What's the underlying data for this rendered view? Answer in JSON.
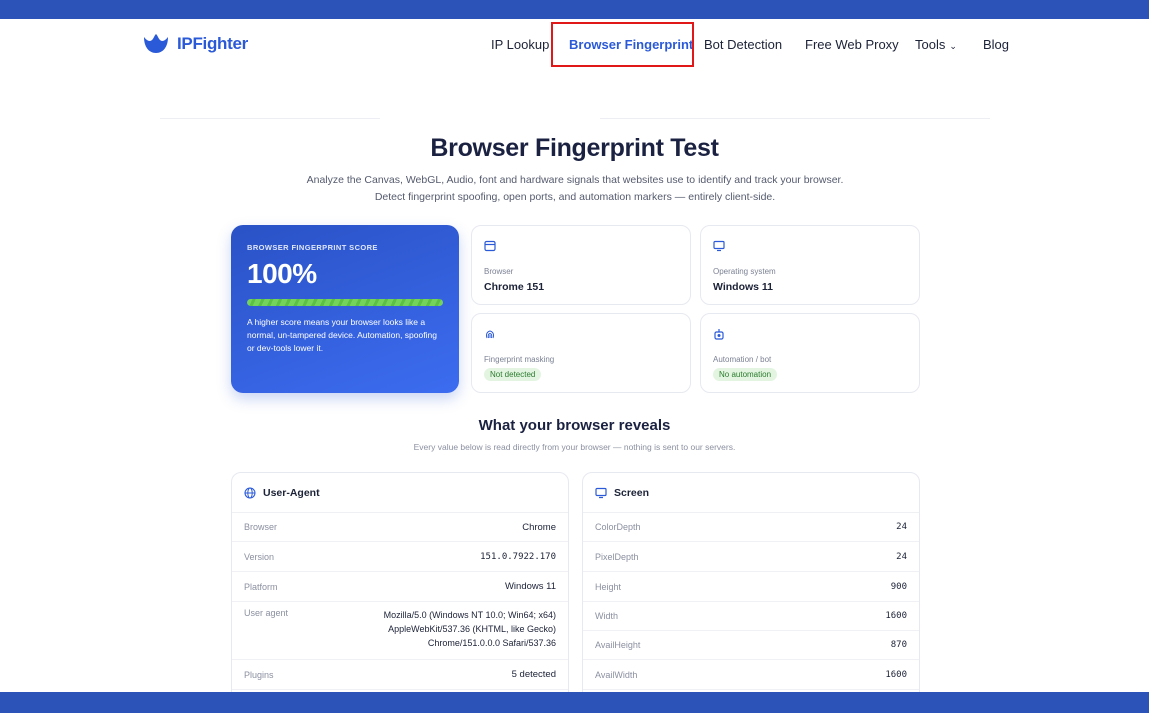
{
  "header": {
    "logo_text": "IPFighter",
    "nav": [
      {
        "label": "IP Lookup"
      },
      {
        "label": "Browser Fingerprint"
      },
      {
        "label": "Bot Detection"
      },
      {
        "label": "Free Web Proxy"
      },
      {
        "label": "Tools"
      },
      {
        "label": "Blog"
      }
    ]
  },
  "hero": {
    "title": "Browser Fingerprint Test",
    "subtitle": "Analyze the Canvas, WebGL, Audio, font and hardware signals that websites use to identify and track your browser. Detect fingerprint spoofing, open ports, and automation markers — entirely client-side."
  },
  "score": {
    "label": "BROWSER FINGERPRINT SCORE",
    "value": "100%",
    "percent": 100,
    "description": "A higher score means your browser looks like a normal, un-tampered device. Automation, spoofing or dev-tools lower it."
  },
  "cards": {
    "browser": {
      "label": "Browser",
      "value": "Chrome 151"
    },
    "os": {
      "label": "Operating system",
      "value": "Windows 11"
    },
    "masking": {
      "label": "Fingerprint masking",
      "badge": "Not detected"
    },
    "automation": {
      "label": "Automation / bot",
      "badge": "No automation"
    }
  },
  "reveals": {
    "title": "What your browser reveals",
    "subtitle": "Every value below is read directly from your browser — nothing is sent to our servers."
  },
  "user_agent_panel": {
    "title": "User-Agent",
    "rows": [
      {
        "label": "Browser",
        "value": "Chrome"
      },
      {
        "label": "Version",
        "value": "151.0.7922.170"
      },
      {
        "label": "Platform",
        "value": "Windows 11"
      },
      {
        "label": "User agent",
        "value": "Mozilla/5.0 (Windows NT 10.0; Win64; x64) AppleWebKit/537.36 (KHTML, like Gecko) Chrome/151.0.0.0 Safari/537.36"
      },
      {
        "label": "Plugins",
        "value": "5 detected"
      }
    ]
  },
  "screen_panel": {
    "title": "Screen",
    "rows": [
      {
        "label": "ColorDepth",
        "value": "24"
      },
      {
        "label": "PixelDepth",
        "value": "24"
      },
      {
        "label": "Height",
        "value": "900"
      },
      {
        "label": "Width",
        "value": "1600"
      },
      {
        "label": "AvailHeight",
        "value": "870"
      },
      {
        "label": "AvailWidth",
        "value": "1600"
      }
    ]
  },
  "colors": {
    "brand": "#2b5ad8",
    "bars": "#2c54b8",
    "highlight": "#e01818",
    "badge_green": "#2b7a2e"
  }
}
